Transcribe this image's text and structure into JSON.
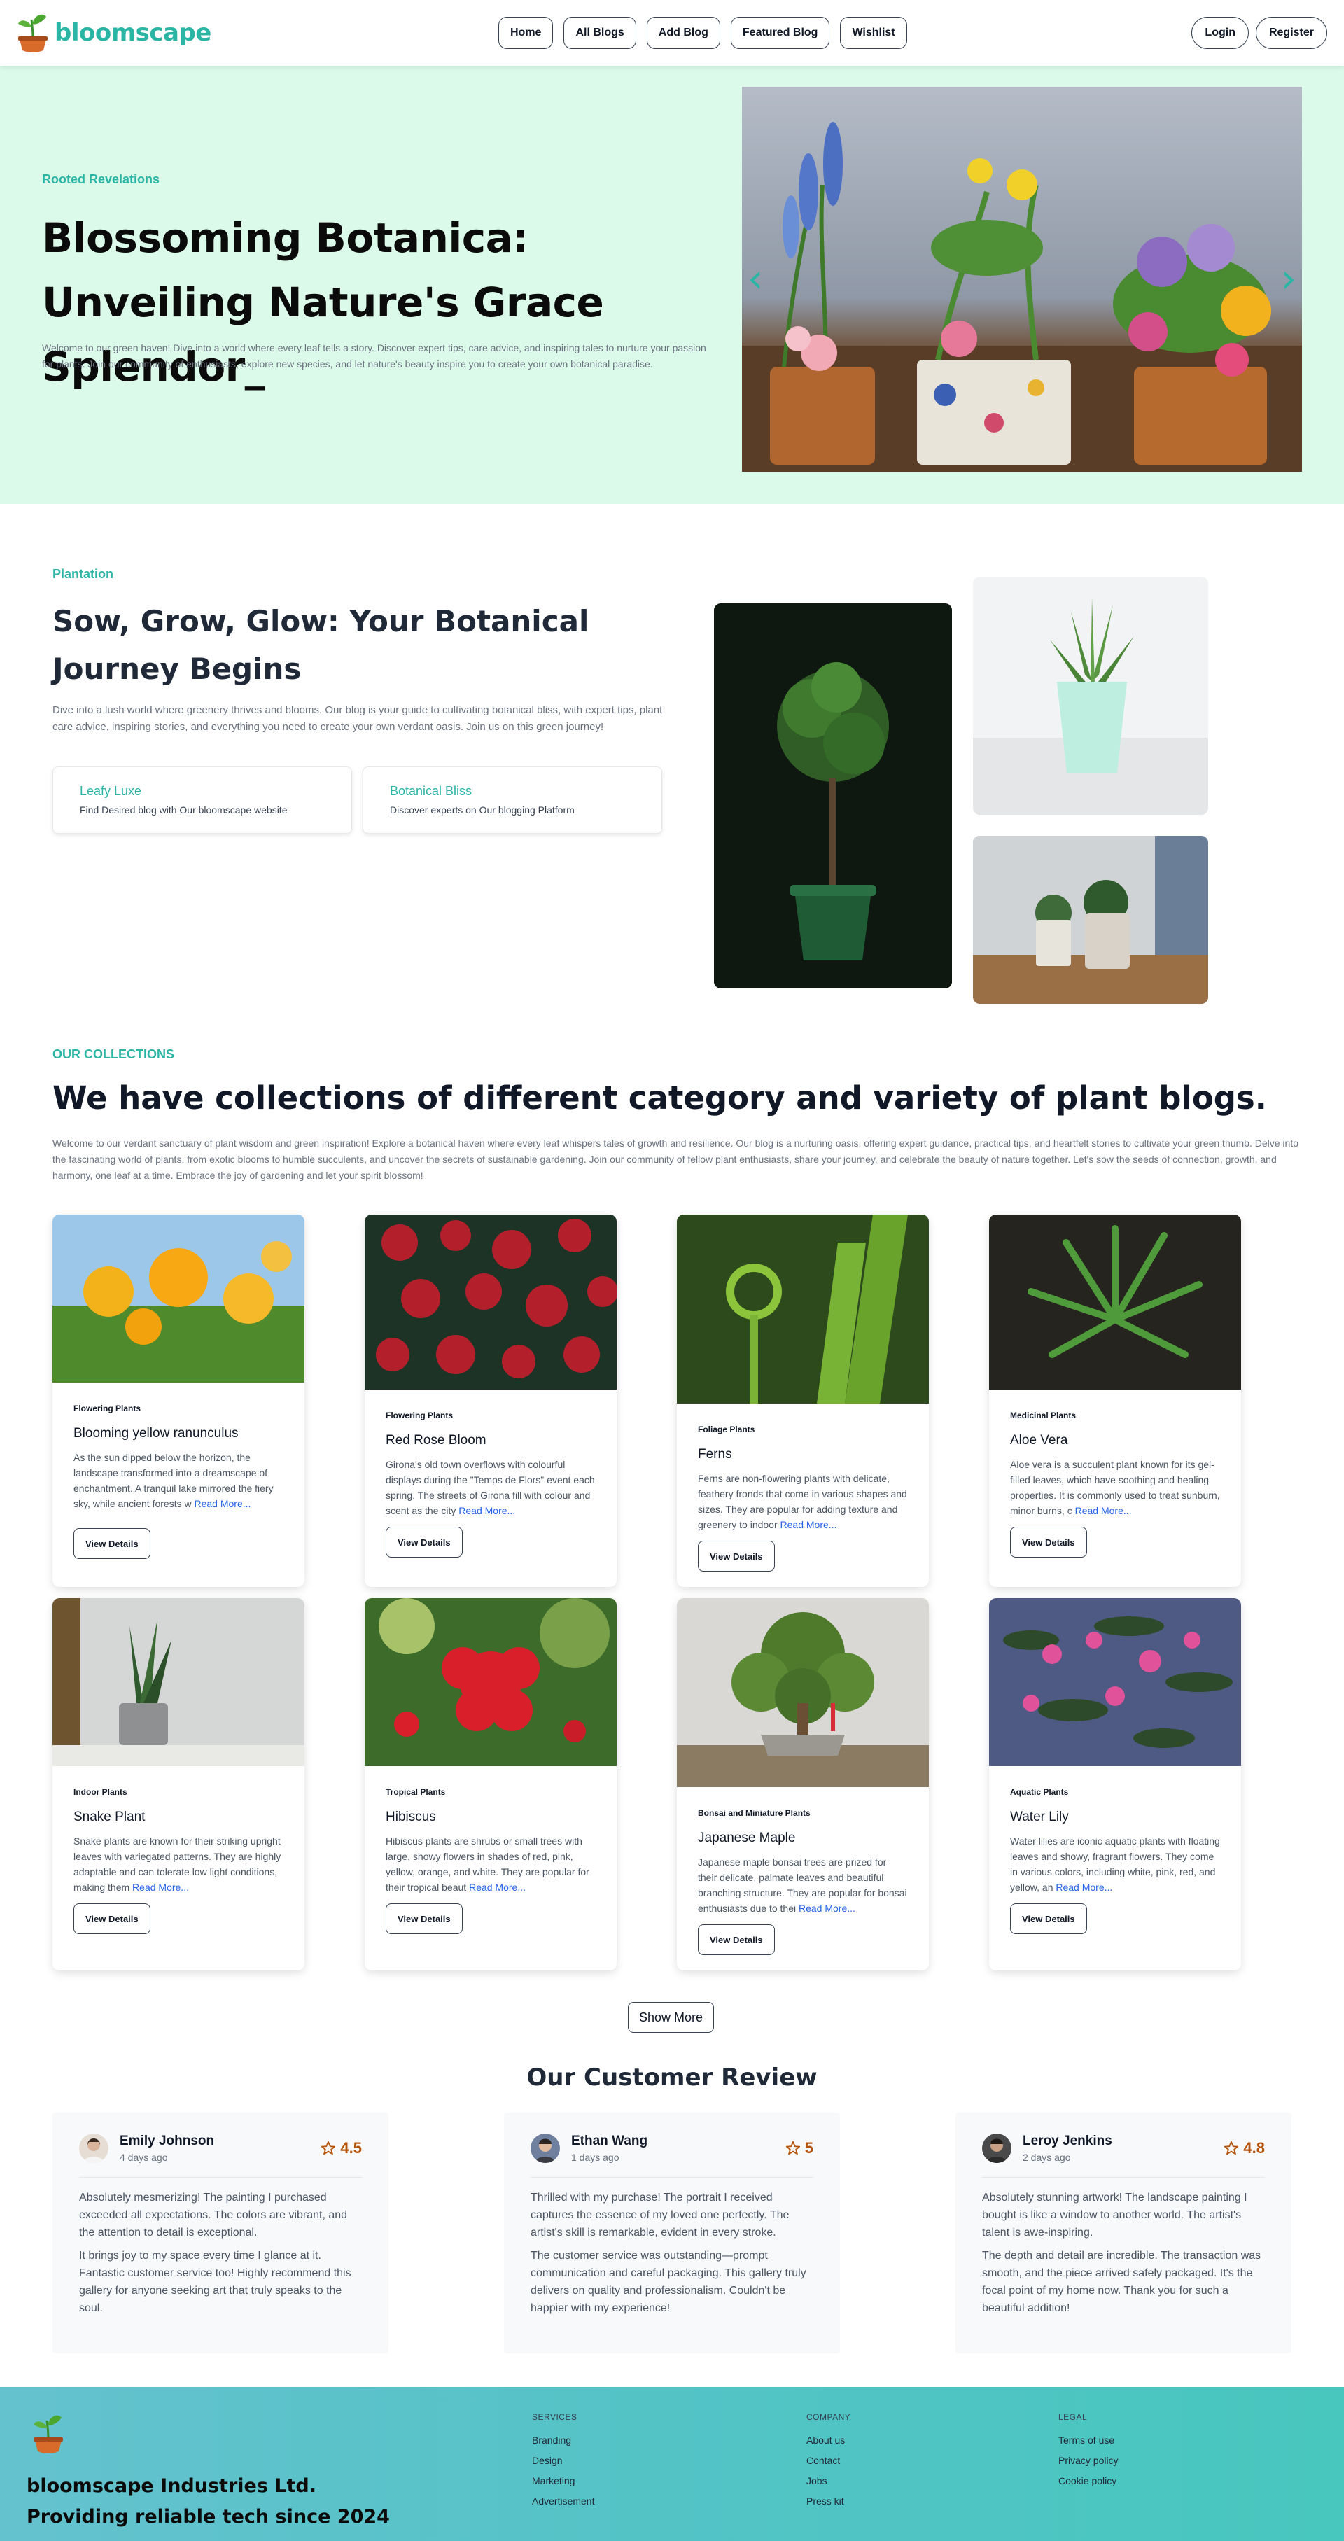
{
  "nav": {
    "brand": "bloomscape",
    "links": [
      "Home",
      "All Blogs",
      "Add Blog",
      "Featured Blog",
      "Wishlist"
    ],
    "login": "Login",
    "register": "Register"
  },
  "hero": {
    "eyebrow": "Rooted Revelations",
    "title": "Blossoming Botanica: Unveiling Nature's Grace Splendor_",
    "description": "Welcome to our green haven! Dive into a world where every leaf tells a story. Discover expert tips, care advice, and inspiring tales to nurture your passion for plants. Join our community of enthusiasts, explore new species, and let nature's beauty inspire you to create your own botanical paradise.",
    "prev_icon": "chevron-left-icon",
    "next_icon": "chevron-right-icon"
  },
  "plantation": {
    "eyebrow": "Plantation",
    "title": "Sow, Grow, Glow: Your Botanical Journey Begins",
    "description": "Dive into a lush world where greenery thrives and blooms. Our blog is your guide to cultivating botanical bliss, with expert tips, plant care advice, inspiring stories, and everything you need to create your own verdant oasis. Join us on this green journey!",
    "features": [
      {
        "title": "Leafy Luxe",
        "subtitle": "Find Desired blog with Our bloomscape website"
      },
      {
        "title": "Botanical Bliss",
        "subtitle": "Discover experts on Our blogging Platform"
      }
    ]
  },
  "collections": {
    "eyebrow": "OUR COLLECTIONS",
    "title": "We have collections of different category and variety of plant blogs.",
    "description": "Welcome to our verdant sanctuary of plant wisdom and green inspiration! Explore a botanical haven where every leaf whispers tales of growth and resilience. Our blog is a nurturing oasis, offering expert guidance, practical tips, and heartfelt stories to cultivate your green thumb. Delve into the fascinating world of plants, from exotic blooms to humble succulents, and uncover the secrets of sustainable gardening. Join our community of fellow plant enthusiasts, share your journey, and celebrate the beauty of nature together. Let's sow the seeds of connection, growth, and harmony, one leaf at a time. Embrace the joy of gardening and let your spirit blossom!",
    "read_more": "Read More...",
    "view_details": "View Details",
    "show_more": "Show More",
    "cards": [
      {
        "category": "Flowering Plants",
        "name": "Blooming yellow ranunculus",
        "text": "As the sun dipped below the horizon, the landscape transformed into a dreamscape of enchantment. A tranquil lake mirrored the fiery sky, while ancient forests w"
      },
      {
        "category": "Flowering Plants",
        "name": "Red Rose Bloom",
        "text": "Girona's old town overflows with colourful displays during the \"Temps de Flors\" event each spring. The streets of Girona fill with colour and scent as the city"
      },
      {
        "category": "Foliage Plants",
        "name": "Ferns",
        "text": "Ferns are non-flowering plants with delicate, feathery fronds that come in various shapes and sizes. They are popular for adding texture and greenery to indoor"
      },
      {
        "category": "Medicinal Plants",
        "name": "Aloe Vera",
        "text": "Aloe vera is a succulent plant known for its gel-filled leaves, which have soothing and healing properties. It is commonly used to treat sunburn, minor burns, c"
      },
      {
        "category": "Indoor Plants",
        "name": "Snake Plant",
        "text": "Snake plants are known for their striking upright leaves with variegated patterns. They are highly adaptable and can tolerate low light conditions, making them"
      },
      {
        "category": "Tropical Plants",
        "name": "Hibiscus",
        "text": "Hibiscus plants are shrubs or small trees with large, showy flowers in shades of red, pink, yellow, orange, and white. They are popular for their tropical beaut"
      },
      {
        "category": "Bonsai and Miniature Plants",
        "name": "Japanese Maple",
        "text": "Japanese maple bonsai trees are prized for their delicate, palmate leaves and beautiful branching structure. They are popular for bonsai enthusiasts due to thei"
      },
      {
        "category": "Aquatic Plants",
        "name": "Water Lily",
        "text": "Water lilies are iconic aquatic plants with floating leaves and showy, fragrant flowers. They come in various colors, including white, pink, red, and yellow, an"
      }
    ]
  },
  "reviews": {
    "heading": "Our Customer Review",
    "items": [
      {
        "name": "Emily Johnson",
        "date": "4 days ago",
        "rating": "4.5",
        "paragraphs": [
          "Absolutely mesmerizing! The painting I purchased exceeded all expectations. The colors are vibrant, and the attention to detail is exceptional.",
          "It brings joy to my space every time I glance at it. Fantastic customer service too! Highly recommend this gallery for anyone seeking art that truly speaks to the soul."
        ]
      },
      {
        "name": "Ethan Wang",
        "date": "1 days ago",
        "rating": "5",
        "paragraphs": [
          "Thrilled with my purchase! The portrait I received captures the essence of my loved one perfectly. The artist's skill is remarkable, evident in every stroke.",
          "The customer service was outstanding—prompt communication and careful packaging. This gallery truly delivers on quality and professionalism. Couldn't be happier with my experience!"
        ]
      },
      {
        "name": "Leroy Jenkins",
        "date": "2 days ago",
        "rating": "4.8",
        "paragraphs": [
          "Absolutely stunning artwork! The landscape painting I bought is like a window to another world. The artist's talent is awe-inspiring.",
          "The depth and detail are incredible. The transaction was smooth, and the piece arrived safely packaged. It's the focal point of my home now. Thank you for such a beautiful addition!"
        ]
      }
    ]
  },
  "footer": {
    "company_line1": "bloomscape Industries Ltd.",
    "company_line2": "Providing reliable tech since 2024",
    "columns": [
      {
        "title": "SERVICES",
        "links": [
          "Branding",
          "Design",
          "Marketing",
          "Advertisement"
        ]
      },
      {
        "title": "COMPANY",
        "links": [
          "About us",
          "Contact",
          "Jobs",
          "Press kit"
        ]
      },
      {
        "title": "LEGAL",
        "links": [
          "Terms of use",
          "Privacy policy",
          "Cookie policy"
        ]
      }
    ]
  },
  "colors": {
    "accent": "#2bb5a5",
    "hero_bg": "#dcfae9",
    "link": "#2563eb",
    "rating": "#b45309"
  }
}
